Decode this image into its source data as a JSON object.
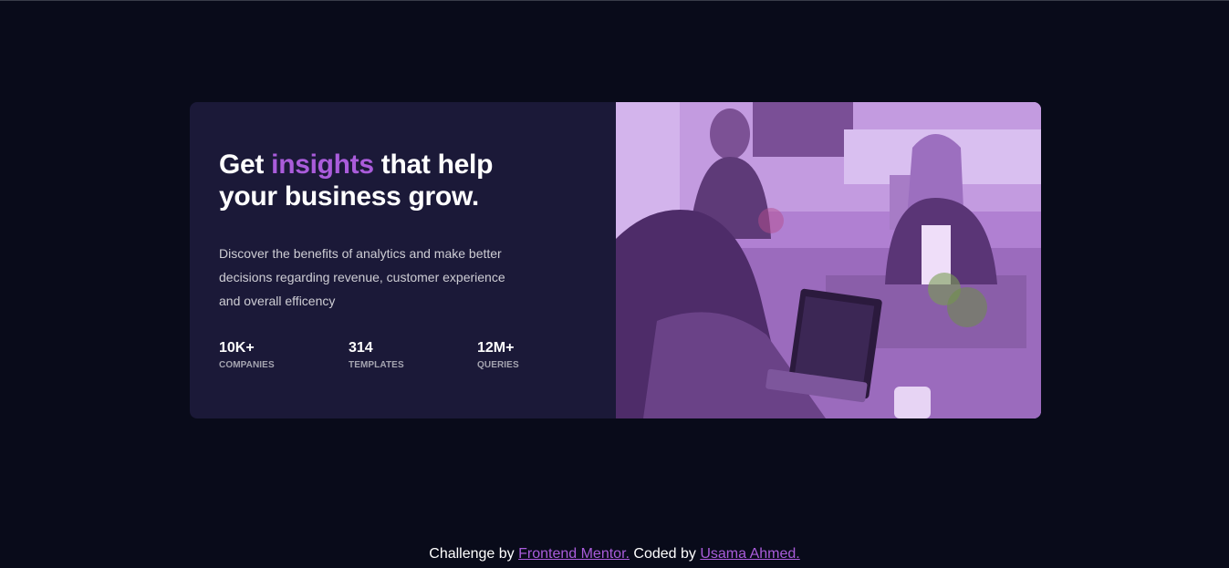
{
  "card": {
    "headline": {
      "before": "Get ",
      "accent": "insights",
      "after": " that help your business grow."
    },
    "description": "Discover the benefits of analytics and make better decisions regarding revenue, customer experience and overall efficency",
    "stats": [
      {
        "value": "10K+",
        "label": "COMPANIES"
      },
      {
        "value": "314",
        "label": "TEMPLATES"
      },
      {
        "value": "12M+",
        "label": "QUERIES"
      }
    ]
  },
  "attribution": {
    "prefix": "Challenge by ",
    "link1": "Frontend Mentor.",
    "middle": " Coded by ",
    "link2": "Usama Ahmed."
  },
  "colors": {
    "page_background": "#090b1a",
    "card_background": "#1b1938",
    "accent": "#aa5cdb",
    "image_tint": "#b27fd6"
  }
}
